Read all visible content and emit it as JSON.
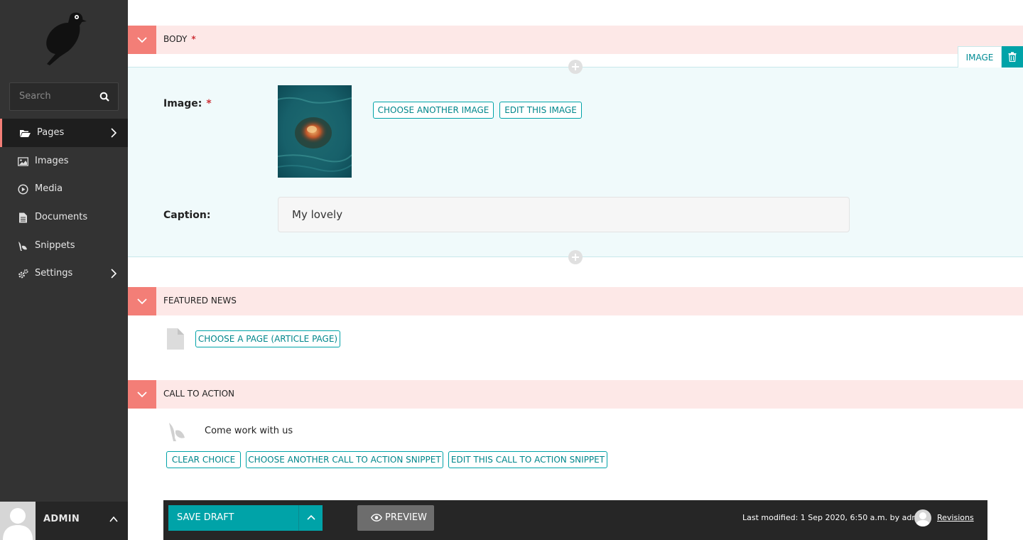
{
  "sidebar": {
    "search_placeholder": "Search",
    "items": [
      {
        "label": "Pages"
      },
      {
        "label": "Images"
      },
      {
        "label": "Media"
      },
      {
        "label": "Documents"
      },
      {
        "label": "Snippets"
      },
      {
        "label": "Settings"
      }
    ],
    "account": {
      "name": "ADMIN"
    }
  },
  "sections": {
    "body": {
      "title": "BODY",
      "required": "*"
    },
    "featured": {
      "title": "FEATURED NEWS"
    },
    "cta": {
      "title": "CALL TO ACTION"
    }
  },
  "image_block": {
    "tag": "IMAGE",
    "image_label": "Image:",
    "required": "*",
    "choose_another": "CHOOSE ANOTHER IMAGE",
    "edit_image": "EDIT THIS IMAGE",
    "caption_label": "Caption:",
    "caption_value": "My lovely"
  },
  "featured_news": {
    "choose_page": "CHOOSE A PAGE (ARTICLE PAGE)"
  },
  "call_to_action": {
    "snippet_title": "Come work with us",
    "clear": "CLEAR CHOICE",
    "choose_another": "CHOOSE ANOTHER CALL TO ACTION SNIPPET",
    "edit": "EDIT THIS CALL TO ACTION SNIPPET"
  },
  "footer": {
    "save_draft": "SAVE DRAFT",
    "preview": "PREVIEW",
    "last_modified": "Last modified: 1 Sep 2020, 6:50 a.m. by admin",
    "revisions": "Revisions"
  },
  "colors": {
    "sidebar_bg": "#333333",
    "accent_teal": "#00a3a8",
    "header_salmon": "#f37e77",
    "header_bg": "#fde8e7",
    "block_bg": "#f0fafb"
  }
}
